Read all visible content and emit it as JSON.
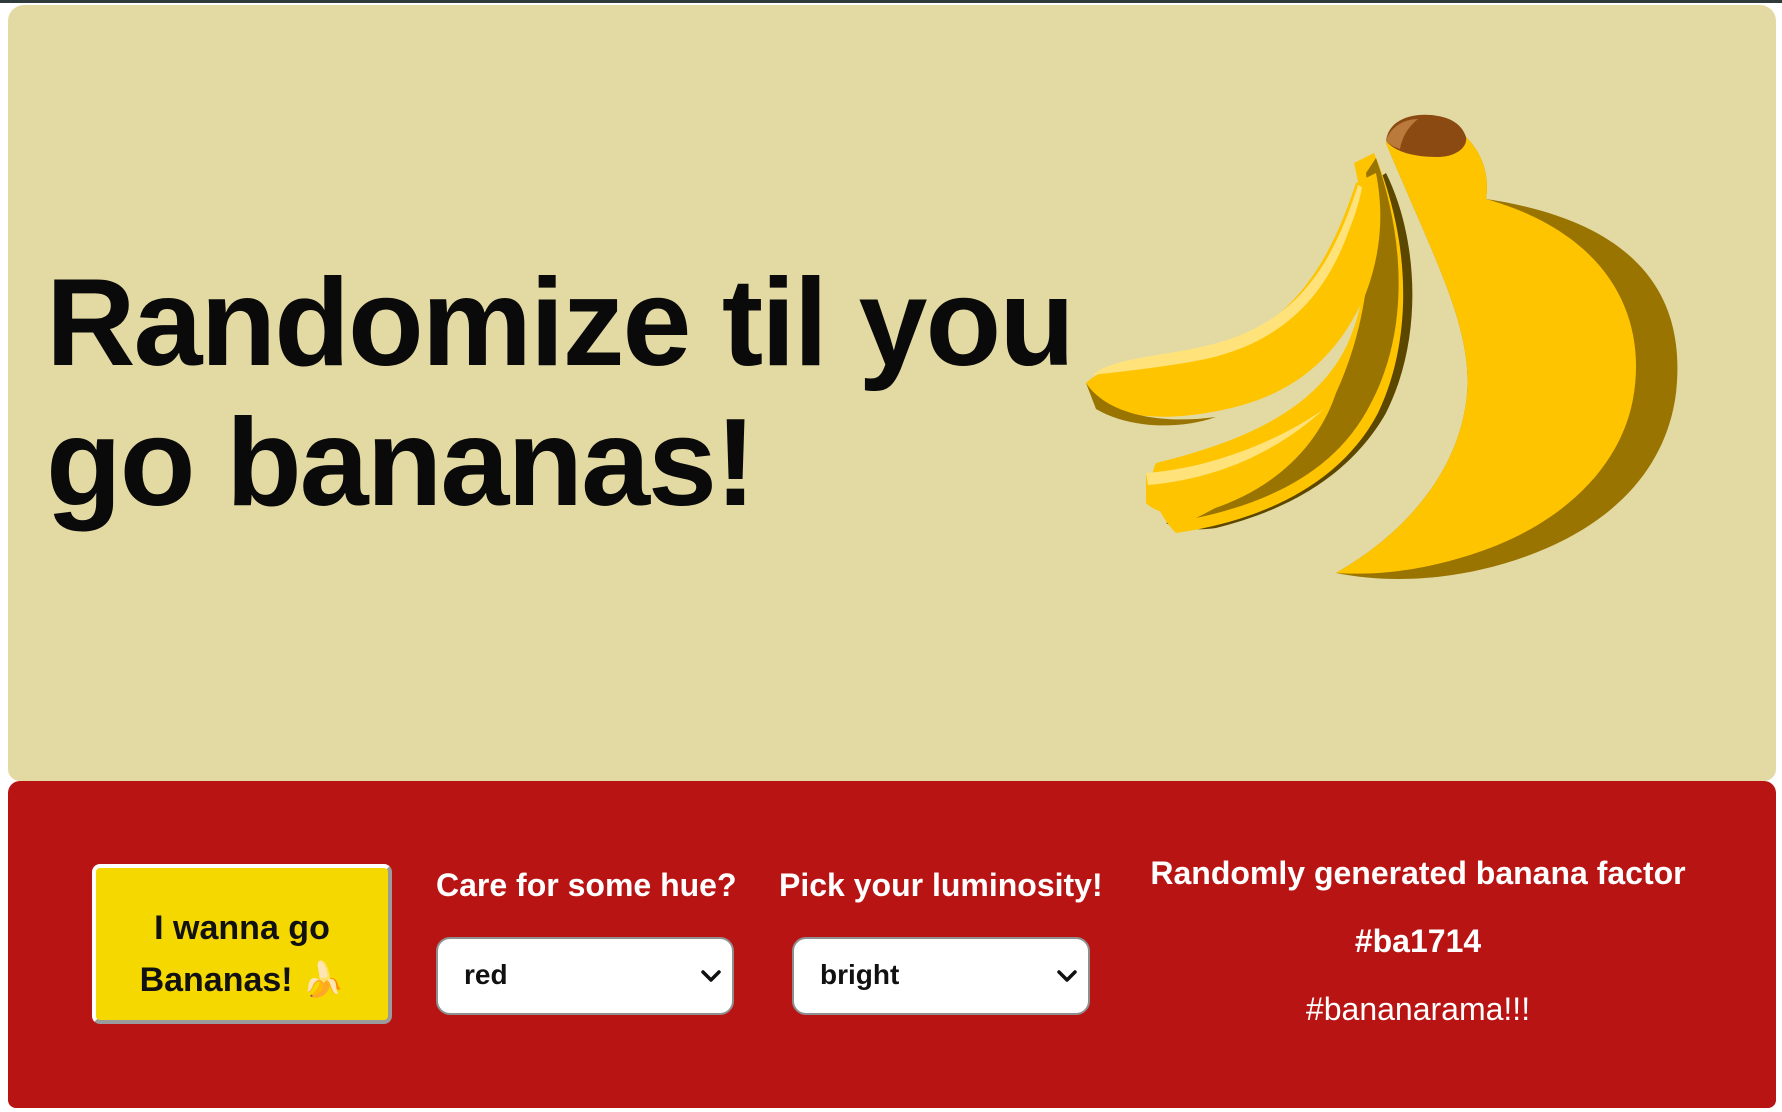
{
  "hero": {
    "title": "Randomize til you go bananas!",
    "background": "#e3daa3",
    "image": "banana-bunch-illustration"
  },
  "controls": {
    "background": "#b91414",
    "go_button": {
      "line1": "I wanna go",
      "line2": "Bananas! 🍌",
      "background": "#f5d800"
    },
    "hue": {
      "label": "Care for some hue?",
      "selected": "red"
    },
    "luminosity": {
      "label": "Pick your luminosity!",
      "selected": "bright"
    },
    "factor": {
      "label": "Randomly generated banana factor",
      "hex": "#ba1714",
      "hashtag": "#bananarama!!!"
    }
  }
}
